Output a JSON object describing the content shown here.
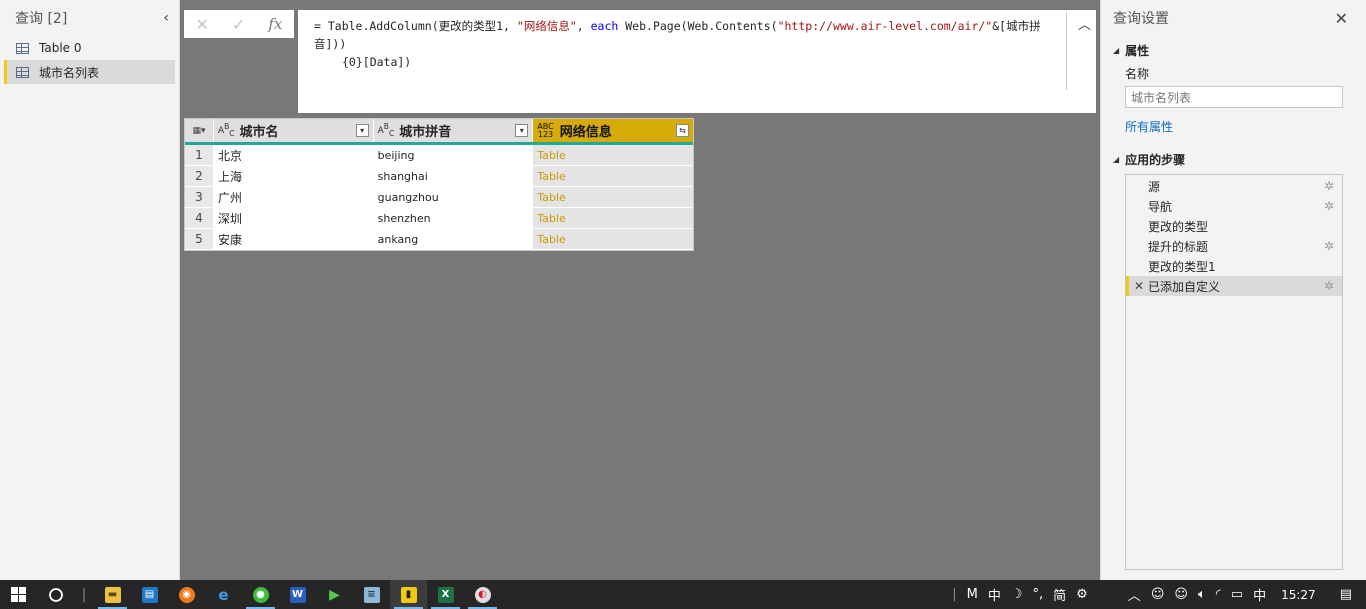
{
  "queries_pane": {
    "title": "查询 [2]",
    "items": [
      {
        "label": "Table 0",
        "active": false
      },
      {
        "label": "城市名列表",
        "active": true
      }
    ]
  },
  "formula_bar": {
    "line1_a": "= Table.AddColumn(更改的类型1, ",
    "line1_str1": "\"网络信息\"",
    "line1_b": ", ",
    "line1_kw": "each",
    "line1_c": " Web.Page(Web.Contents(",
    "line1_str2": "\"http://www.air-level.com/air/\"",
    "line1_d": "&[城市拼音]))",
    "line2": "{0}[Data])",
    "fx_label": "fx"
  },
  "grid": {
    "columns": [
      {
        "type": "ABC",
        "name": "城市名"
      },
      {
        "type": "ABC",
        "name": "城市拼音"
      },
      {
        "type": "ABC 123",
        "name": "网络信息"
      }
    ],
    "rows": [
      {
        "n": "1",
        "city": "北京",
        "pinyin": "beijing",
        "info": "Table"
      },
      {
        "n": "2",
        "city": "上海",
        "pinyin": "shanghai",
        "info": "Table"
      },
      {
        "n": "3",
        "city": "广州",
        "pinyin": "guangzhou",
        "info": "Table"
      },
      {
        "n": "4",
        "city": "深圳",
        "pinyin": "shenzhen",
        "info": "Table"
      },
      {
        "n": "5",
        "city": "安康",
        "pinyin": "ankang",
        "info": "Table"
      }
    ]
  },
  "settings_pane": {
    "title": "查询设置",
    "properties_header": "属性",
    "name_label": "名称",
    "name_value": "城市名列表",
    "all_properties": "所有属性",
    "steps_header": "应用的步骤",
    "steps": [
      {
        "label": "源",
        "gear": true,
        "active": false
      },
      {
        "label": "导航",
        "gear": true,
        "active": false
      },
      {
        "label": "更改的类型",
        "gear": false,
        "active": false
      },
      {
        "label": "提升的标题",
        "gear": true,
        "active": false
      },
      {
        "label": "更改的类型1",
        "gear": false,
        "active": false
      },
      {
        "label": "已添加自定义",
        "gear": true,
        "active": true
      }
    ]
  },
  "taskbar": {
    "ime": [
      "M",
      "中",
      "☽",
      "°,",
      "简",
      "⚙"
    ],
    "ime_lang": "中",
    "time": "15:27"
  },
  "colors": {
    "accent_yellow": "#f2c811",
    "header_teal": "#1faa95",
    "active_column": "#d6ab07",
    "table_link": "#c99a06"
  }
}
